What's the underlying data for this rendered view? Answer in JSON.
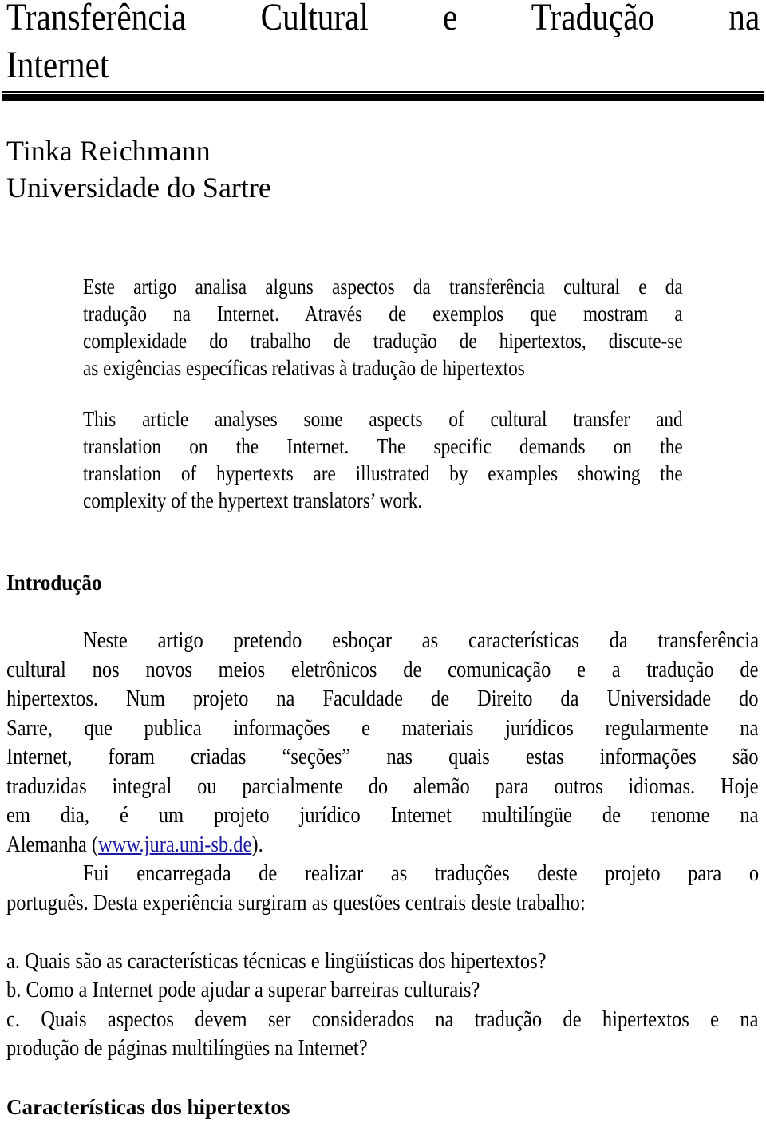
{
  "document": {
    "title_lines": [
      "Transferência Cultural e Tradução na",
      "Internet"
    ],
    "author": {
      "name": "Tinka Reichmann",
      "affiliation": "Universidade do Sartre"
    },
    "abstract_pt": [
      "Este artigo analisa alguns aspectos da transferência cultural e da",
      "tradução na Internet. Através de exemplos que mostram a",
      "complexidade do trabalho de tradução de hipertextos, discute-se",
      "as exigências específicas relativas à tradução de hipertextos"
    ],
    "abstract_en": [
      "This article analyses some aspects of cultural transfer and",
      "translation on the Internet. The specific demands on the",
      "translation of hypertexts are illustrated by examples showing the",
      "complexity of the hypertext translators’ work."
    ],
    "sections": {
      "intro_heading": "Introdução",
      "intro_paragraph_1": [
        "Neste artigo pretendo esboçar as características da transferência",
        "cultural nos novos meios eletrônicos de comunicação e a tradução de",
        "hipertextos. Num projeto na Faculdade de Direito da Universidade do",
        "Sarre, que publica informações e materiais jurídicos regularmente na",
        "Internet, foram criadas “seções” nas quais estas informações são",
        "traduzidas integral ou parcialmente do alemão para outros idiomas. Hoje",
        "em dia, é um projeto jurídico Internet multilíngüe de renome na"
      ],
      "intro_last_line": {
        "before": "Alemanha (",
        "link": "www.jura.uni-sb.de",
        "after": ")."
      },
      "intro_paragraph_2": [
        "Fui encarregada de realizar as traduções deste projeto para o",
        "português. Desta experiência surgiram as questões centrais deste trabalho:"
      ],
      "questions": [
        "a. Quais são as características técnicas e lingüísticas dos hipertextos?",
        "b. Como a  Internet pode ajudar a superar barreiras culturais?",
        "c. Quais aspectos devem ser considerados na tradução de hipertextos e na",
        "produção de páginas multilíngües na Internet?"
      ],
      "next_heading": "Características dos hipertextos"
    },
    "colors": {
      "text": "#000000",
      "link": "#1a1aa6",
      "background": "#ffffff"
    }
  }
}
